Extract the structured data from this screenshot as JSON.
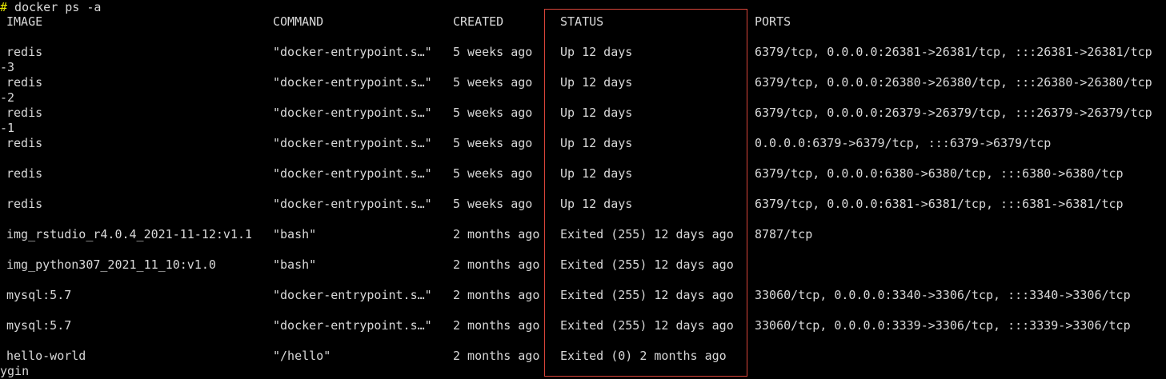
{
  "command": {
    "prompt": "#",
    "text": " docker ps -a"
  },
  "table": {
    "headers": {
      "image": "IMAGE",
      "command": "COMMAND",
      "created": "CREATED",
      "status": "STATUS",
      "ports": "PORTS"
    },
    "rows": [
      {
        "image": "redis",
        "command": "\"docker-entrypoint.s…\"",
        "created": "5 weeks ago",
        "status": "Up 12 days",
        "ports": "6379/tcp, 0.0.0.0:26381->26381/tcp, :::26381->26381/tcp",
        "wrap": "-3"
      },
      {
        "image": "redis",
        "command": "\"docker-entrypoint.s…\"",
        "created": "5 weeks ago",
        "status": "Up 12 days",
        "ports": "6379/tcp, 0.0.0.0:26380->26380/tcp, :::26380->26380/tcp",
        "wrap": "-2"
      },
      {
        "image": "redis",
        "command": "\"docker-entrypoint.s…\"",
        "created": "5 weeks ago",
        "status": "Up 12 days",
        "ports": "6379/tcp, 0.0.0.0:26379->26379/tcp, :::26379->26379/tcp",
        "wrap": "-1"
      },
      {
        "image": "redis",
        "command": "\"docker-entrypoint.s…\"",
        "created": "5 weeks ago",
        "status": "Up 12 days",
        "ports": "0.0.0.0:6379->6379/tcp, :::6379->6379/tcp",
        "wrap": ""
      },
      {
        "image": "redis",
        "command": "\"docker-entrypoint.s…\"",
        "created": "5 weeks ago",
        "status": "Up 12 days",
        "ports": "6379/tcp, 0.0.0.0:6380->6380/tcp, :::6380->6380/tcp",
        "wrap": ""
      },
      {
        "image": "redis",
        "command": "\"docker-entrypoint.s…\"",
        "created": "5 weeks ago",
        "status": "Up 12 days",
        "ports": "6379/tcp, 0.0.0.0:6381->6381/tcp, :::6381->6381/tcp",
        "wrap": ""
      },
      {
        "image": "img_rstudio_r4.0.4_2021-11-12:v1.1",
        "command": "\"bash\"",
        "created": "2 months ago",
        "status": "Exited (255) 12 days ago",
        "ports": "8787/tcp",
        "wrap": ""
      },
      {
        "image": "img_python307_2021_11_10:v1.0",
        "command": "\"bash\"",
        "created": "2 months ago",
        "status": "Exited (255) 12 days ago",
        "ports": "",
        "wrap": ""
      },
      {
        "image": "mysql:5.7",
        "command": "\"docker-entrypoint.s…\"",
        "created": "2 months ago",
        "status": "Exited (255) 12 days ago",
        "ports": "33060/tcp, 0.0.0.0:3340->3306/tcp, :::3340->3306/tcp",
        "wrap": ""
      },
      {
        "image": "mysql:5.7",
        "command": "\"docker-entrypoint.s…\"",
        "created": "2 months ago",
        "status": "Exited (255) 12 days ago",
        "ports": "33060/tcp, 0.0.0.0:3339->3306/tcp, :::3339->3306/tcp",
        "wrap": ""
      },
      {
        "image": "hello-world",
        "command": "\"/hello\"",
        "created": "2 months ago",
        "status": "Exited (0) 2 months ago",
        "ports": "",
        "wrap": "ygin"
      }
    ]
  },
  "colors": {
    "background": "#000000",
    "text": "#d8d8d8",
    "prompt": "#e8e800",
    "highlight": "#d9453a"
  }
}
